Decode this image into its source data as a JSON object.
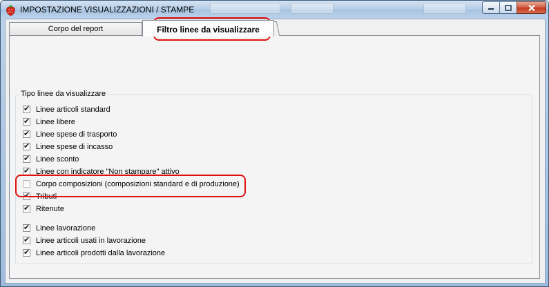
{
  "window": {
    "title": "IMPOSTAZIONE VISUALIZZAZIONI / STAMPE",
    "icon": "strawberry-icon"
  },
  "tabs": [
    {
      "label": "Corpo del report",
      "active": false
    },
    {
      "label": "Filtro linee da visualizzare",
      "active": true
    }
  ],
  "group": {
    "title": "Tipo linee da visualizzare",
    "items": [
      {
        "label": "Linee articoli standard",
        "checked": true
      },
      {
        "label": "Linee libere",
        "checked": true
      },
      {
        "label": "Linee spese di trasporto",
        "checked": true
      },
      {
        "label": "Linee spese di incasso",
        "checked": true
      },
      {
        "label": "Linee sconto",
        "checked": true
      },
      {
        "label": "Linee con indicatore \"Non stampare\" attivo",
        "checked": true
      },
      {
        "label": "Corpo composizioni (composizioni standard e di produzione)",
        "checked": false
      },
      {
        "label": "Tributi",
        "checked": true
      },
      {
        "label": "Ritenute",
        "checked": true
      },
      {
        "label": "Linee lavorazione",
        "checked": true
      },
      {
        "label": "Linee articoli usati in lavorazione",
        "checked": true
      },
      {
        "label": "Linee articoli prodotti dalla lavorazione",
        "checked": true
      }
    ]
  },
  "colors": {
    "highlight": "#e01010",
    "accent": "#3c5a78"
  }
}
